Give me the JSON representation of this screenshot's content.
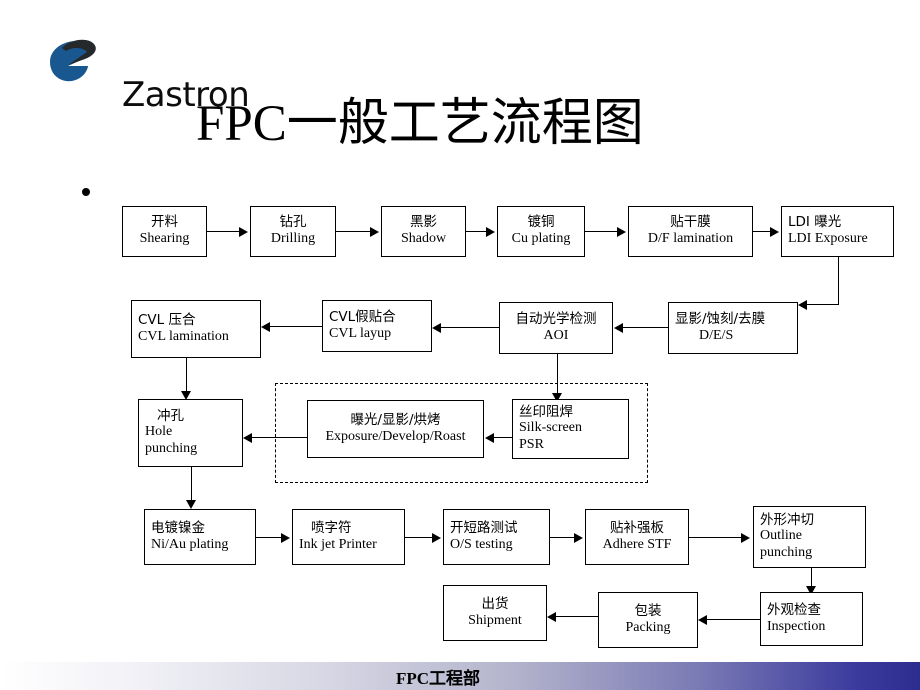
{
  "slide": {
    "logo_text": "Zastron",
    "logo_icon": "zastron-swoosh-logo",
    "title": "FPC一般工艺流程图",
    "footer_text": "FPC工程部",
    "accent_color": "#2d2d8f",
    "logo_blue": "#1d5fa5"
  },
  "flow": {
    "nodes": [
      {
        "id": "shearing",
        "cn": "开料",
        "en": "Shearing"
      },
      {
        "id": "drilling",
        "cn": "钻孔",
        "en": "Drilling"
      },
      {
        "id": "shadow",
        "cn": "黑影",
        "en": "Shadow"
      },
      {
        "id": "cu-plating",
        "cn": "镀铜",
        "en": "Cu plating"
      },
      {
        "id": "df-lamination",
        "cn": "贴干膜",
        "en": "D/F lamination"
      },
      {
        "id": "ldi-exposure",
        "cn": "LDI 曝光",
        "en": "LDI Exposure"
      },
      {
        "id": "des",
        "cn": "显影/蚀刻/去膜",
        "en": "D/E/S"
      },
      {
        "id": "aoi",
        "cn": "自动光学检测",
        "en": "AOI"
      },
      {
        "id": "cvl-layup",
        "cn": "CVL假贴合",
        "en": "CVL layup"
      },
      {
        "id": "cvl-lamination",
        "cn": "CVL 压合",
        "en": "CVL lamination"
      },
      {
        "id": "hole-punching",
        "cn": "冲孔",
        "en": "Hole",
        "en2": "punching"
      },
      {
        "id": "exposure-develop-roast",
        "cn": "曝光/显影/烘烤",
        "en": "Exposure/Develop/Roast"
      },
      {
        "id": "silk-screen",
        "cn": "丝印阻焊",
        "en": "Silk-screen",
        "en2": "PSR"
      },
      {
        "id": "niau-plating",
        "cn": "电镀镍金",
        "en": "Ni/Au plating"
      },
      {
        "id": "ink-jet",
        "cn": "喷字符",
        "en": "Ink jet  Printer"
      },
      {
        "id": "os-testing",
        "cn": "开短路测试",
        "en": "O/S testing"
      },
      {
        "id": "adhere-stf",
        "cn": "贴补强板",
        "en": "Adhere  STF"
      },
      {
        "id": "outline-punching",
        "cn": "外形冲切",
        "en": "Outline",
        "en2": "punching"
      },
      {
        "id": "inspection",
        "cn": "外观检查",
        "en": "Inspection"
      },
      {
        "id": "packing",
        "cn": "包装",
        "en": "Packing"
      },
      {
        "id": "shipment",
        "cn": "出货",
        "en": "Shipment"
      }
    ]
  }
}
